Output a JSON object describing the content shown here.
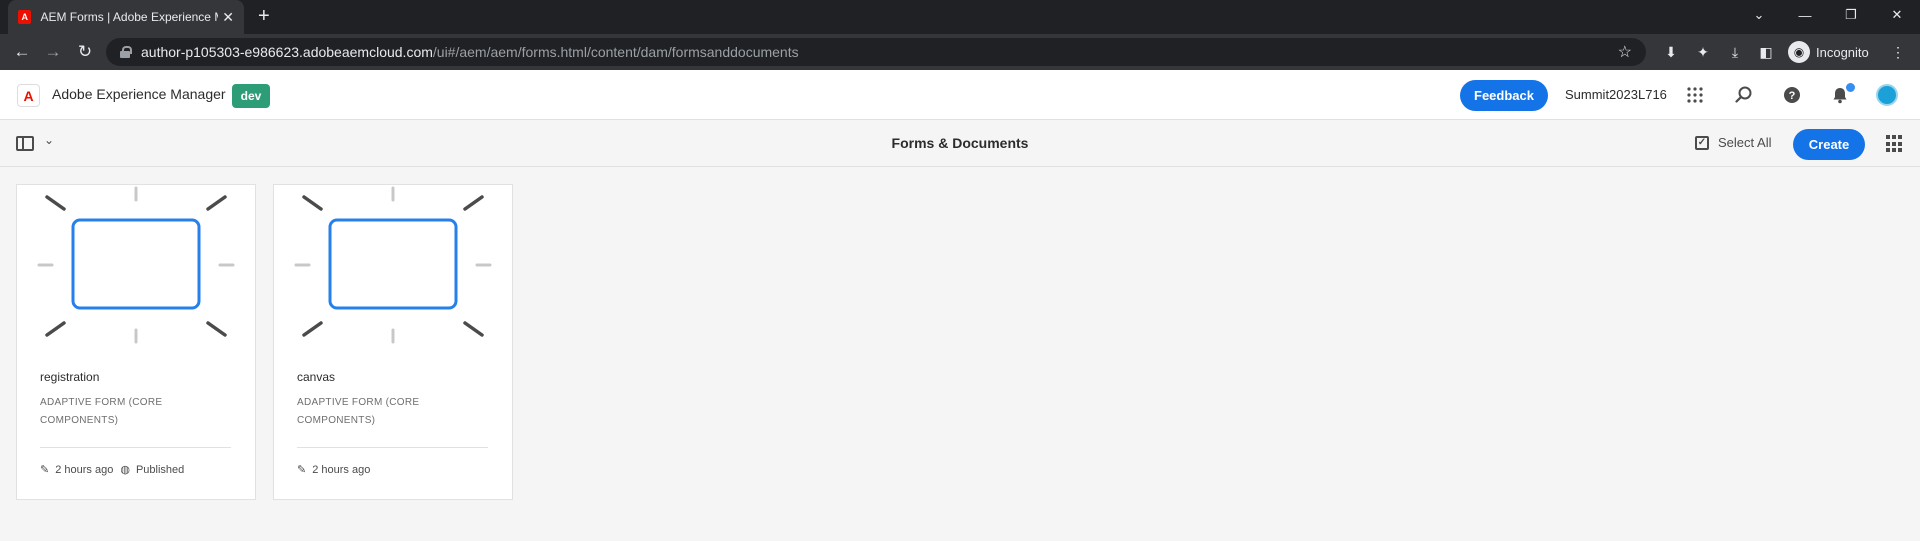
{
  "browser": {
    "tab_title": "AEM Forms | Adobe Experience Manager",
    "url_host": "author-p105303-e986623.adobeaemcloud.com",
    "url_path": "/ui#/aem/aem/forms.html/content/dam/formsanddocuments",
    "profile_label": "Incognito"
  },
  "header": {
    "product_name": "Adobe Experience Manager",
    "environment_badge": "dev",
    "feedback_label": "Feedback",
    "org_name": "Summit2023L716"
  },
  "action_bar": {
    "page_title": "Forms & Documents",
    "select_all_label": "Select All",
    "create_label": "Create"
  },
  "cards": [
    {
      "name": "registration",
      "type": "ADAPTIVE FORM (CORE COMPONENTS)",
      "modified": "2 hours ago",
      "status": "Published"
    },
    {
      "name": "canvas",
      "type": "ADAPTIVE FORM (CORE COMPONENTS)",
      "modified": "2 hours ago",
      "status": ""
    }
  ],
  "colors": {
    "accent": "#1473e6",
    "env_badge": "#2d9d78",
    "thumbnail_frame": "#2680eb"
  }
}
